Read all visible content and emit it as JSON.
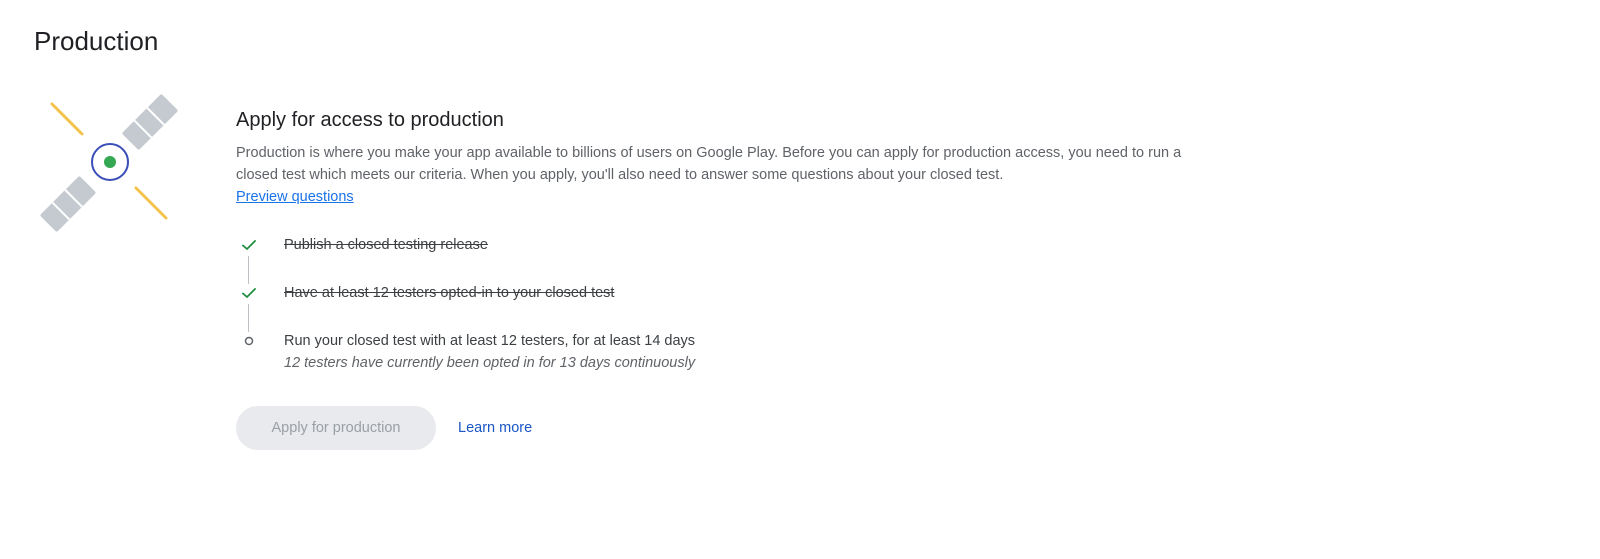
{
  "page": {
    "title": "Production"
  },
  "section": {
    "title": "Apply for access to production",
    "description": "Production is where you make your app available to billions of users on Google Play. Before you can apply for production access, you need to run a closed test which meets our criteria. When you apply, you'll also need to answer some questions about your closed test.",
    "preview_link": "Preview questions"
  },
  "steps": [
    {
      "label": "Publish a closed testing release",
      "status": "done",
      "icon": "check-icon"
    },
    {
      "label": "Have at least 12 testers opted-in to your closed test",
      "status": "done",
      "icon": "check-icon"
    },
    {
      "label": "Run your closed test with at least 12 testers, for at least 14 days",
      "sublabel": "12 testers have currently been opted in for 13 days continuously",
      "status": "pending",
      "icon": "circle-outline-icon"
    }
  ],
  "actions": {
    "apply_label": "Apply for production",
    "learn_more_label": "Learn more"
  },
  "colors": {
    "check": "#1e8e3e",
    "link": "#1a73e8",
    "disabled_bg": "#e8eaed",
    "disabled_text": "#9aa0a6"
  },
  "illustration": {
    "icon": "satellite-icon"
  }
}
